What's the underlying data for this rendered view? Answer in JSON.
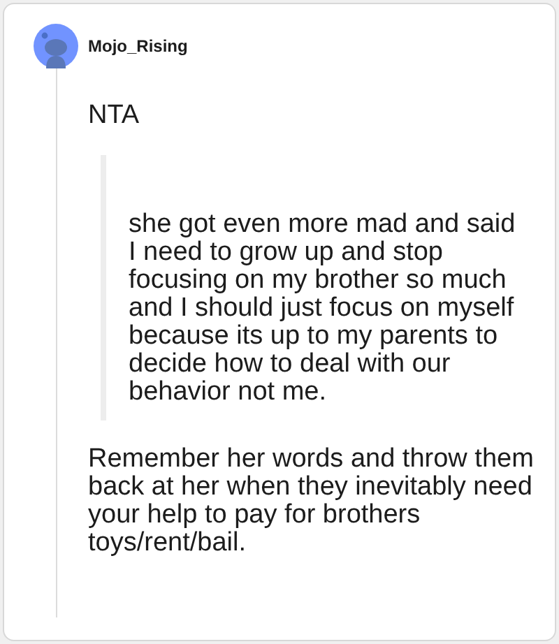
{
  "comment": {
    "author": "Mojo_Rising",
    "paragraphs": [
      {
        "kind": "text",
        "text": "NTA"
      },
      {
        "kind": "quote",
        "text": "she got even more mad and said I need to grow up and stop focusing on my brother so much and I should just focus on myself because its up to my parents to decide how to deal with our behavior not me."
      },
      {
        "kind": "text",
        "text": "Remember her words and throw them back at her when they inevitably need your help to pay for brothers toys/rent/bail."
      }
    ]
  }
}
